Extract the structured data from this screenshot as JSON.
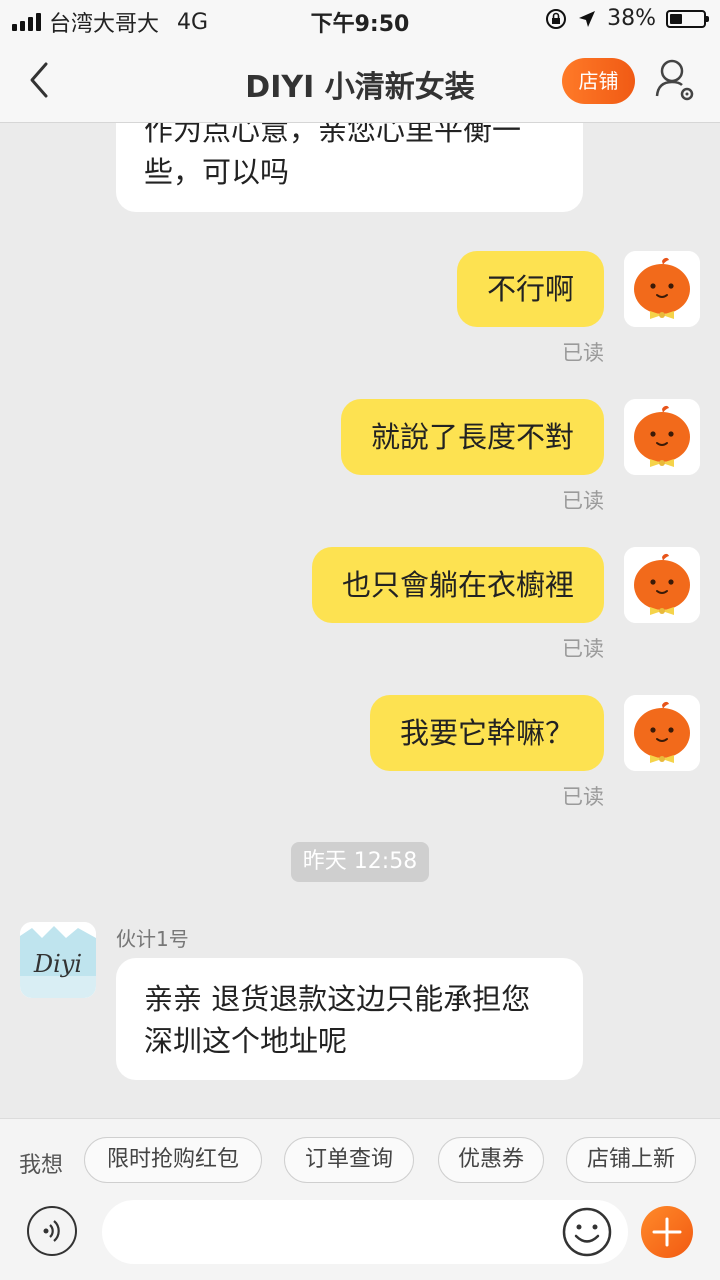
{
  "status_bar": {
    "carrier": "台湾大哥大",
    "network": "4G",
    "time": "下午9:50",
    "battery_text": "38%",
    "battery_level": 0.38
  },
  "header": {
    "title": "DIYI 小清新女装",
    "shop_button": "店铺"
  },
  "messages": {
    "partial_incoming": "作为点心意，亲您心里平衡一些，可以吗",
    "outgoing": [
      {
        "text": "不行啊",
        "status": "已读"
      },
      {
        "text": "就說了長度不對",
        "status": "已读"
      },
      {
        "text": "也只會躺在衣櫥裡",
        "status": "已读"
      },
      {
        "text": "我要它幹嘛？",
        "status": "已读"
      }
    ],
    "timestamp": "昨天 12:58",
    "incoming": {
      "sender": "伙计1号",
      "avatar_text": "Diyi",
      "text": "亲亲 退货退款这边只能承担您深圳这个地址呢"
    }
  },
  "quick_replies": {
    "label": "我想",
    "chips": [
      "限时抢购红包",
      "订单查询",
      "优惠券",
      "店铺上新"
    ]
  },
  "colors": {
    "outgoing_bubble": "#fde251",
    "accent": "#f26a1b",
    "background": "#ebebeb"
  },
  "icons": [
    "back-arrow-icon",
    "user-settings-icon",
    "voice-icon",
    "emoji-icon",
    "plus-icon"
  ]
}
